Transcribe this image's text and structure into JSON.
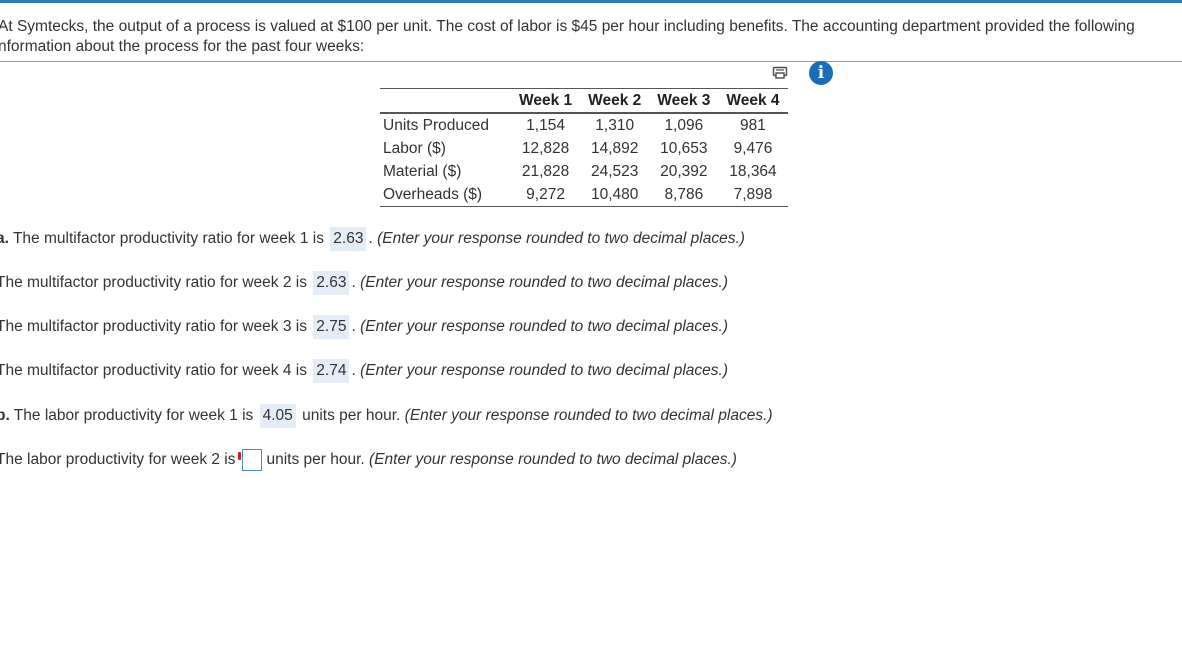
{
  "intro": {
    "line1": "At Symtecks, the output of a process is valued at $100 per unit. The cost of labor is $45 per hour including benefits. The accounting department provided the following",
    "line2": "nformation about the process for the past four weeks:"
  },
  "icons": {
    "print": "print-icon",
    "info": "info-icon",
    "info_glyph": "i"
  },
  "table": {
    "headers": [
      "",
      "Week 1",
      "Week 2",
      "Week 3",
      "Week 4"
    ],
    "rows": [
      {
        "label": "Units Produced",
        "values": [
          "1,154",
          "1,310",
          "1,096",
          "981"
        ]
      },
      {
        "label": "Labor ($)",
        "values": [
          "12,828",
          "14,892",
          "10,653",
          "9,476"
        ]
      },
      {
        "label": "Material ($)",
        "values": [
          "21,828",
          "24,523",
          "20,392",
          "18,364"
        ]
      },
      {
        "label": "Overheads ($)",
        "values": [
          "9,272",
          "10,480",
          "8,786",
          "7,898"
        ]
      }
    ]
  },
  "questions": {
    "q1": {
      "prefix": "a.",
      "text": " The multifactor productivity ratio for week 1 is",
      "answer": "2.63",
      "hint": "(Enter your response rounded to two decimal places.)"
    },
    "q2": {
      "text": "The multifactor productivity ratio for week 2 is",
      "answer": "2.63",
      "hint": "(Enter your response rounded to two decimal places.)"
    },
    "q3": {
      "text": "The multifactor productivity ratio for week 3 is",
      "answer": "2.75",
      "hint": "(Enter your response rounded to two decimal places.)"
    },
    "q4": {
      "text": "The multifactor productivity ratio for week 4 is",
      "answer": "2.74",
      "hint": "(Enter your response rounded to two decimal places.)"
    },
    "q5": {
      "prefix": "b.",
      "text": " The labor productivity for week 1 is",
      "answer": "4.05",
      "suffix": "units per hour.",
      "hint": "(Enter your response rounded to two decimal places.)"
    },
    "q6": {
      "text": "The labor productivity for week 2 is",
      "input_value": "",
      "suffix": "units per hour.",
      "hint": "(Enter your response rounded to two decimal places.)"
    }
  },
  "colors": {
    "accent": "#2f7db6",
    "answer_bg": "#e4edf7",
    "info_icon": "#1c6db9",
    "required": "#d42020"
  }
}
